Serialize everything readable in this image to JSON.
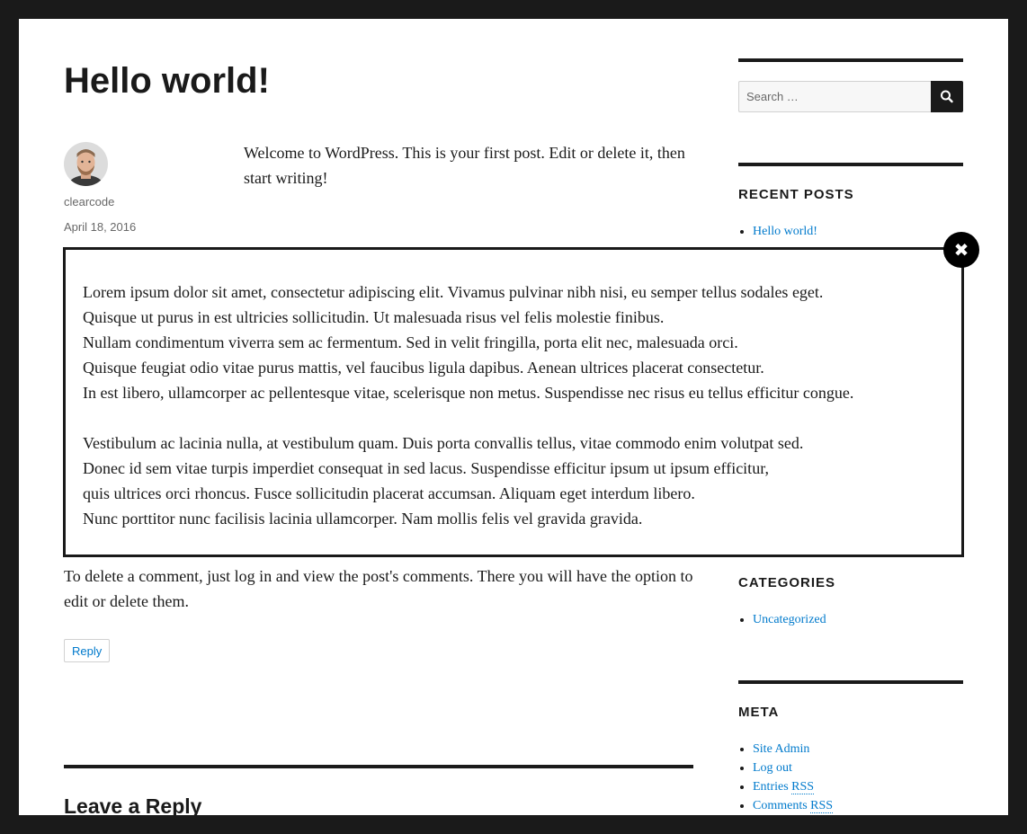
{
  "post": {
    "title": "Hello world!",
    "author": "clearcode",
    "date": "April 18, 2016",
    "excerpt": "Welcome to WordPress. This is your first post. Edit or delete it, then start writing!"
  },
  "comment": {
    "text": "To delete a comment, just log in and view the post's comments. There you will have the option to edit or delete them.",
    "reply_label": "Reply"
  },
  "leave_reply": {
    "title": "Leave a Reply"
  },
  "sidebar": {
    "search": {
      "placeholder": "Search …",
      "button_icon": "search-icon"
    },
    "recent_posts": {
      "title": "RECENT POSTS",
      "items": [
        "Hello world!"
      ]
    },
    "categories": {
      "title": "CATEGORIES",
      "items": [
        "Uncategorized"
      ]
    },
    "meta": {
      "title": "META",
      "items": [
        {
          "text": "Site Admin"
        },
        {
          "text": "Log out"
        },
        {
          "text": "Entries ",
          "abbr": "RSS"
        },
        {
          "text": "Comments ",
          "abbr": "RSS"
        }
      ]
    }
  },
  "popup": {
    "close_icon": "close-icon",
    "close_glyph": "✖",
    "paragraph_1": [
      "Lorem ipsum dolor sit amet, consectetur adipiscing elit. Vivamus pulvinar nibh nisi, eu semper tellus sodales eget.",
      "Quisque ut purus in est ultricies sollicitudin. Ut malesuada risus vel felis molestie finibus.",
      "Nullam condimentum viverra sem ac fermentum. Sed in velit fringilla, porta elit nec, malesuada orci.",
      "Quisque feugiat odio vitae purus mattis, vel faucibus ligula dapibus. Aenean ultrices placerat consectetur.",
      "In est libero, ullamcorper ac pellentesque vitae, scelerisque non metus. Suspendisse nec risus eu tellus efficitur congue."
    ],
    "paragraph_2": [
      "Vestibulum ac lacinia nulla, at vestibulum quam. Duis porta convallis tellus, vitae commodo enim volutpat sed.",
      "Donec id sem vitae turpis imperdiet consequat in sed lacus. Suspendisse efficitur ipsum ut ipsum efficitur,",
      "quis ultrices orci rhoncus. Fusce sollicitudin placerat accumsan. Aliquam eget interdum libero.",
      "Nunc porttitor nunc facilisis lacinia ullamcorper. Nam mollis felis vel gravida gravida."
    ]
  },
  "colors": {
    "frame": "#1a1a1a",
    "text": "#1a1a1a",
    "link": "#007acc",
    "muted": "#686868"
  }
}
